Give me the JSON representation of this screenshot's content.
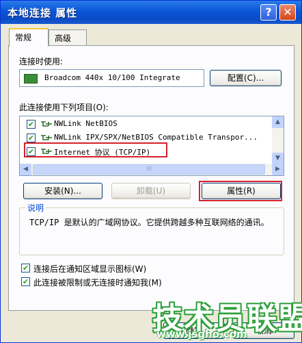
{
  "window": {
    "title": "本地连接 属性",
    "help_label": "?",
    "close_label": "✕"
  },
  "tabs": [
    {
      "label": "常规"
    },
    {
      "label": "高级"
    }
  ],
  "connect_using": {
    "label": "连接时使用:",
    "device": "Broadcom 440x 10/100 Integrate",
    "configure_label": "配置(C)..."
  },
  "items_section": {
    "label": "此连接使用下列项目(O):",
    "items": [
      {
        "label": "NWLink NetBIOS",
        "checked": true
      },
      {
        "label": "NWLink IPX/SPX/NetBIOS Compatible Transpor...",
        "checked": true
      },
      {
        "label": "Internet 协议 (TCP/IP)",
        "checked": true
      }
    ],
    "scroll_glyph": "III"
  },
  "actions": {
    "install": "安装(N)...",
    "uninstall": "卸载(U)",
    "properties": "属性(R)"
  },
  "description": {
    "title": "说明",
    "text": "TCP/IP 是默认的广域网协议。它提供跨越多种互联网络的通讯。"
  },
  "options": [
    {
      "label": "连接后在通知区域显示图标(W)",
      "checked": true
    },
    {
      "label": "此连接被限制或无连接时通知我(M)",
      "checked": true
    }
  ],
  "dialog_buttons": {
    "ok": "确定",
    "cancel": "取消"
  },
  "watermark": {
    "brand": "技术员联盟",
    "url": "www.jsgho.com"
  },
  "colors": {
    "highlight": "#D6202C",
    "titlebar": "#0955D8",
    "check": "#21A121"
  }
}
